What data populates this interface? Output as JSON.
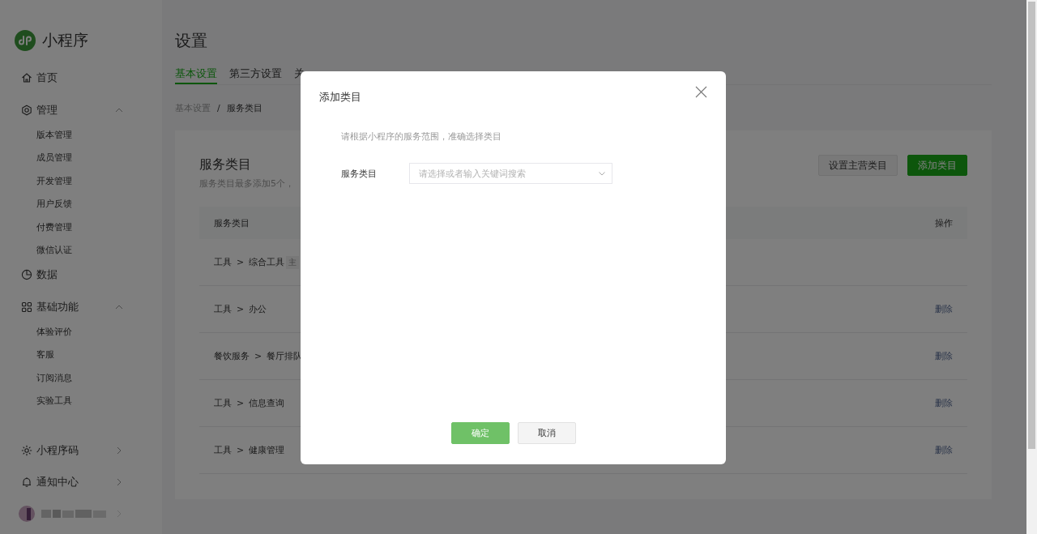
{
  "sidebar": {
    "logo": "小程序",
    "nav": [
      {
        "label": "首页",
        "kind": "link"
      },
      {
        "label": "管理",
        "kind": "group",
        "expanded": true,
        "children": [
          {
            "label": "版本管理"
          },
          {
            "label": "成员管理"
          },
          {
            "label": "开发管理"
          },
          {
            "label": "用户反馈"
          },
          {
            "label": "付费管理"
          },
          {
            "label": "微信认证"
          }
        ]
      },
      {
        "label": "数据",
        "kind": "link"
      },
      {
        "label": "基础功能",
        "kind": "group",
        "expanded": true,
        "children": [
          {
            "label": "体验评价"
          },
          {
            "label": "客服"
          },
          {
            "label": "订阅消息"
          },
          {
            "label": "实验工具"
          }
        ]
      }
    ],
    "footer": [
      {
        "label": "小程序码",
        "kind": "more"
      },
      {
        "label": "通知中心",
        "kind": "more"
      },
      {
        "kind": "user"
      }
    ]
  },
  "main": {
    "title": "设置",
    "tabs": [
      {
        "label": "基本设置",
        "selected": true
      },
      {
        "label": "第三方设置",
        "selected": false
      },
      {
        "label": "关",
        "selected": false
      }
    ],
    "breadcrumb": {
      "items": [
        "基本设置",
        "服务类目"
      ],
      "separator": "/"
    },
    "card": {
      "title": "服务类目",
      "description": "服务类目最多添加5个，",
      "buttons": [
        {
          "label": "设置主营类目",
          "kind": "default"
        },
        {
          "label": "添加类目",
          "kind": "primary"
        }
      ],
      "table": {
        "columns": [
          "服务类目",
          "操作"
        ],
        "separator": ">",
        "rows": [
          {
            "path": [
              "工具",
              "综合工具"
            ],
            "badge": "主"
          },
          {
            "path": [
              "工具",
              "办公"
            ],
            "action": "删除"
          },
          {
            "path": [
              "餐饮服务",
              "餐厅排队"
            ],
            "action": "删除"
          },
          {
            "path": [
              "工具",
              "信息查询"
            ],
            "action": "删除"
          },
          {
            "path": [
              "工具",
              "健康管理"
            ],
            "action": "删除"
          }
        ]
      }
    }
  },
  "dialog": {
    "title": "添加类目",
    "hint": "请根据小程序的服务范围，准确选择类目",
    "field": {
      "label": "服务类目",
      "placeholder": "请选择或者输入关键词搜索"
    },
    "buttons": [
      {
        "label": "确定",
        "kind": "primary"
      },
      {
        "label": "取消",
        "kind": "default"
      }
    ]
  }
}
